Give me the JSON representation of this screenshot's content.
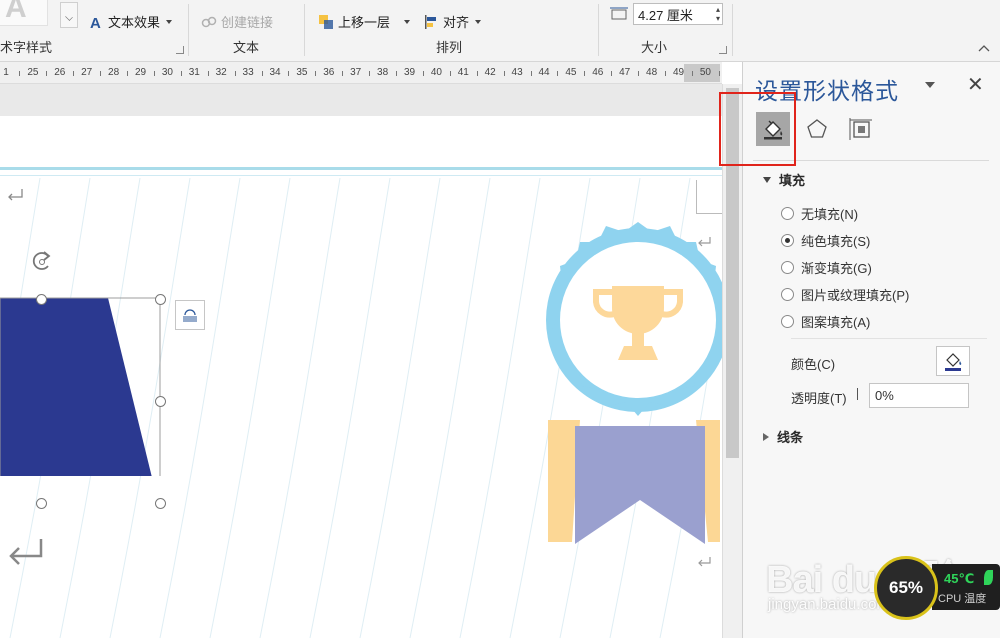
{
  "ribbon": {
    "groups": {
      "art_text_style": "术字样式",
      "text": "文本",
      "arrange": "排列",
      "size": "大小"
    },
    "buttons": {
      "text_effects": "文本效果",
      "create_link": "创建链接",
      "bring_forward": "上移一层",
      "align": "对齐"
    },
    "width_value": "4.27 厘米"
  },
  "ruler": {
    "labels": [
      "1",
      "25",
      "26",
      "27",
      "28",
      "29",
      "30",
      "31",
      "32",
      "33",
      "34",
      "35",
      "36",
      "37",
      "38",
      "39",
      "40",
      "41",
      "42",
      "43",
      "44",
      "45",
      "46",
      "47",
      "48",
      "49",
      "50"
    ]
  },
  "pane": {
    "title": "设置形状格式",
    "fill_section": "填充",
    "fill_options": [
      {
        "label": "无填充(N)",
        "selected": false
      },
      {
        "label": "纯色填充(S)",
        "selected": true
      },
      {
        "label": "渐变填充(G)",
        "selected": false
      },
      {
        "label": "图片或纹理填充(P)",
        "selected": false
      },
      {
        "label": "图案填充(A)",
        "selected": false
      }
    ],
    "color_label": "颜色(C)",
    "transparency_label": "透明度(T)",
    "transparency_value": "0%",
    "line_section": "线条",
    "active_tab": "fill-and-line",
    "tabs": [
      "fill-line-icon",
      "effects-pentagon-icon",
      "layout-size-icon"
    ]
  },
  "colors": {
    "trapezoid": "#2b3990",
    "badge_ring": "#8fd3ef",
    "trophy": "#fdd89a",
    "ribbon_purple": "#9aa0cf",
    "ribbon_tan": "#fcd795",
    "pane_title": "#2b579a",
    "highlight": "#e0241b"
  },
  "watermark": {
    "brand": "Bai du 经验",
    "url": "jingyan.baidu.com"
  },
  "cpu_widget": {
    "percent": "65%",
    "temp": "45℃",
    "label": "CPU 温度"
  }
}
